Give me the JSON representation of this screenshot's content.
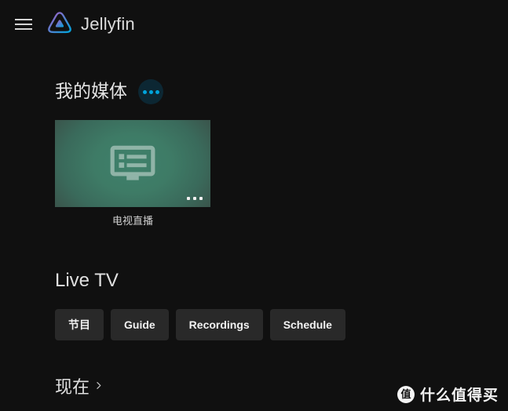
{
  "header": {
    "menu_icon": "hamburger-menu-icon",
    "logo_icon": "jellyfin-logo-icon",
    "brand_name": "Jellyfin"
  },
  "my_media": {
    "title": "我的媒体",
    "more_button_icon": "ellipsis-icon",
    "cards": [
      {
        "label": "电视直播",
        "icon": "dvr-monitor-icon",
        "overflow_icon": "ellipsis-icon"
      }
    ]
  },
  "live_tv": {
    "title": "Live TV",
    "buttons": [
      {
        "label": "节目"
      },
      {
        "label": "Guide"
      },
      {
        "label": "Recordings"
      },
      {
        "label": "Schedule"
      }
    ]
  },
  "now": {
    "title": "现在",
    "chevron_icon": "chevron-right-icon"
  },
  "watermark": {
    "badge": "值",
    "text": "什么值得买"
  },
  "colors": {
    "background": "#101010",
    "accent": "#00a4dc",
    "more_button_bg": "#0c2733",
    "button_bg": "#292929",
    "card_green_center": "#3f816b",
    "card_green_edge": "#3a4a44",
    "text_primary": "#e8e8e8"
  }
}
